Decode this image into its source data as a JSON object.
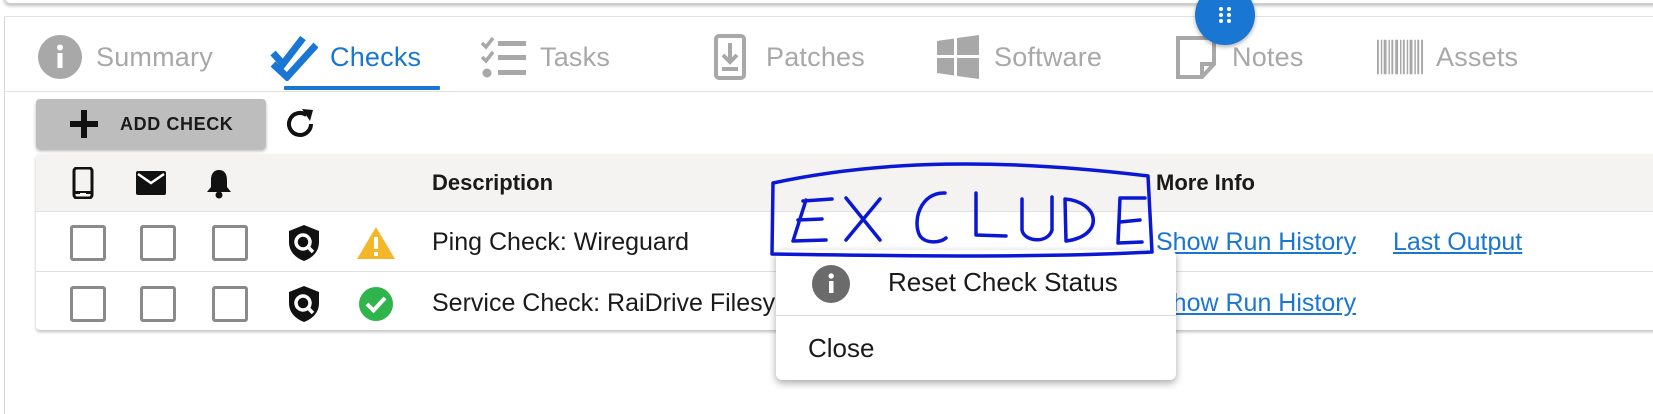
{
  "tabs": [
    {
      "label": "Summary",
      "icon": "info-icon",
      "active": false
    },
    {
      "label": "Checks",
      "icon": "checks-icon",
      "active": true
    },
    {
      "label": "Tasks",
      "icon": "tasks-icon",
      "active": false
    },
    {
      "label": "Patches",
      "icon": "patches-icon",
      "active": false
    },
    {
      "label": "Software",
      "icon": "windows-icon",
      "active": false
    },
    {
      "label": "Notes",
      "icon": "notes-icon",
      "active": false
    },
    {
      "label": "Assets",
      "icon": "barcode-icon",
      "active": false
    }
  ],
  "toolbar": {
    "add_check_label": "ADD CHECK"
  },
  "table": {
    "headers": {
      "description": "Description",
      "more_info": "More Info"
    },
    "rows": [
      {
        "description": "Ping Check: Wireguard",
        "status": "warning",
        "link1": "Show Run History",
        "link2": "Last Output"
      },
      {
        "description": "Service Check: RaiDrive Filesy",
        "status": "passing",
        "link1": "Show Run History",
        "link2": ""
      }
    ]
  },
  "context_menu": {
    "items": [
      {
        "label": "Reset Check Status",
        "icon": "info-icon"
      },
      {
        "label": "Close"
      }
    ]
  },
  "annotation": {
    "text": "EXCLUDE",
    "color": "#0a18d6"
  },
  "colors": {
    "accent": "#1976d2",
    "warning": "#f4b72a",
    "success": "#2fb54b"
  }
}
